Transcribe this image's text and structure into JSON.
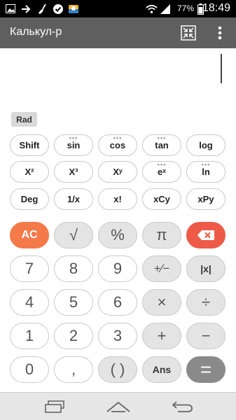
{
  "status_bar": {
    "icons": [
      "image-icon",
      "arrow-right-icon",
      "broom-icon",
      "check-badge-icon",
      "weather-app-icon"
    ],
    "battery_percent": "77%",
    "time": "18:49"
  },
  "app_bar": {
    "title": "Калькул-р",
    "actions": [
      "compact-view-icon",
      "overflow-menu-icon"
    ]
  },
  "display": {
    "expression": ""
  },
  "angle_mode": "Rad",
  "function_keys": {
    "row1": [
      "Shift",
      "sin",
      "cos",
      "tan",
      "log"
    ],
    "row2": [
      "X²",
      "X³",
      "Xʸ",
      "eˣ",
      "ln"
    ],
    "row3": [
      "Deg",
      "1/x",
      "x!",
      "xCy",
      "xPy"
    ]
  },
  "keys": {
    "ac": "AC",
    "sqrt": "√",
    "percent": "%",
    "pi": "π",
    "seven": "7",
    "eight": "8",
    "nine": "9",
    "plus_minus": "+∕−",
    "abs": "|x|",
    "four": "4",
    "five": "5",
    "six": "6",
    "multiply": "×",
    "divide": "÷",
    "one": "1",
    "two": "2",
    "three": "3",
    "plus": "+",
    "minus": "−",
    "zero": "0",
    "comma": ",",
    "parens": "( )",
    "ans": "Ans",
    "equals": "="
  },
  "colors": {
    "app_bar": "#5f5f5f",
    "ac_key": "#f47a4a",
    "backspace_key": "#ee5a48",
    "equals_key": "#8a8a8a",
    "operator_key": "#e4e4e4"
  }
}
